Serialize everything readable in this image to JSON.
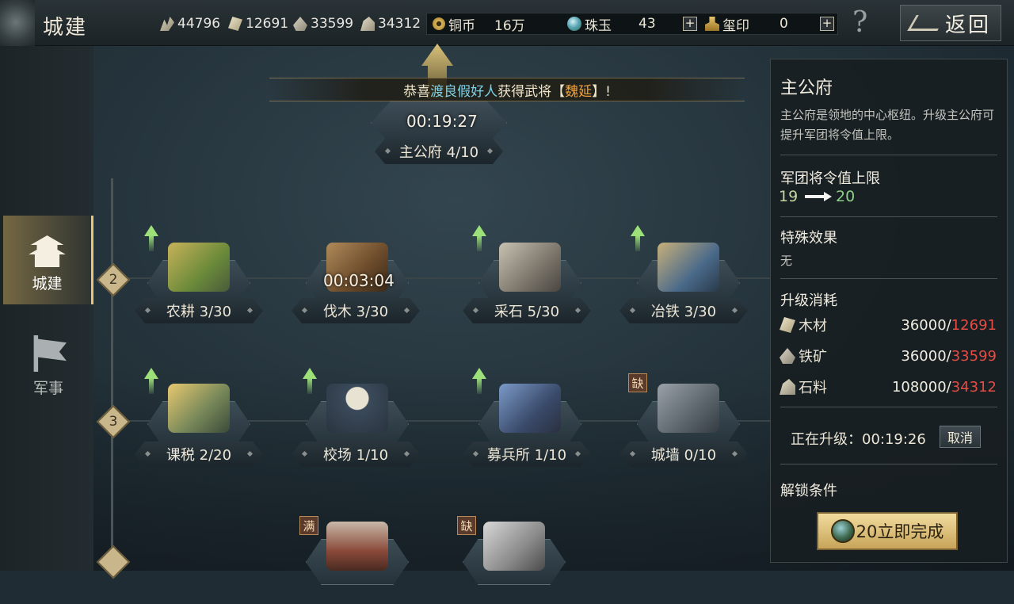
{
  "header": {
    "title": "城建",
    "resources": [
      {
        "icon": "grain-icon",
        "value": "44796"
      },
      {
        "icon": "wood-icon",
        "value": "12691"
      },
      {
        "icon": "iron-ore-icon",
        "value": "33599"
      },
      {
        "icon": "stone-icon",
        "value": "34312"
      }
    ],
    "copper": {
      "label": "铜币",
      "value": "16万"
    },
    "jade": {
      "label": "珠玉",
      "value": "43"
    },
    "seal": {
      "label": "玺印",
      "value": "0"
    },
    "plus_label": "+",
    "help_label": "?",
    "back_label": "返回"
  },
  "sidebar": {
    "tabs": [
      {
        "label": "城建",
        "active": true
      },
      {
        "label": "军事",
        "active": false
      }
    ]
  },
  "announcement": {
    "prefix": "恭喜",
    "player": "渡良假好人",
    "middle": "获得武将【",
    "hero": "魏延",
    "suffix": "】!"
  },
  "main_hall": {
    "timer": "00:19:27",
    "label": "主公府 4/10"
  },
  "levels": [
    "2",
    "3"
  ],
  "buildings_row2": [
    {
      "label": "农耕 3/30",
      "upgrade": true,
      "timer": ""
    },
    {
      "label": "伐木 3/30",
      "upgrade": false,
      "timer": "00:03:04"
    },
    {
      "label": "采石 5/30",
      "upgrade": true,
      "timer": ""
    },
    {
      "label": "冶铁 3/30",
      "upgrade": true,
      "timer": ""
    }
  ],
  "buildings_row3": [
    {
      "label": "课税 2/20",
      "upgrade": true
    },
    {
      "label": "校场 1/10",
      "upgrade": true
    },
    {
      "label": "募兵所 1/10",
      "upgrade": true
    },
    {
      "label": "城墙 0/10",
      "upgrade": false,
      "tag": "缺"
    }
  ],
  "row4_tags": [
    "满",
    "缺"
  ],
  "detail_panel": {
    "title": "主公府",
    "description": "主公府是领地的中心枢纽。升级主公府可提升军团将令值上限。",
    "stat_label": "军团将令值上限",
    "stat_from": "19",
    "stat_to": "20",
    "special_label": "特殊效果",
    "special_value": "无",
    "cost_label": "升级消耗",
    "costs": [
      {
        "icon": "wood-icon",
        "name": "木材",
        "need": "36000",
        "have": "12691"
      },
      {
        "icon": "iron-ore-icon",
        "name": "铁矿",
        "need": "36000",
        "have": "33599"
      },
      {
        "icon": "stone-icon",
        "name": "石料",
        "need": "108000",
        "have": "34312"
      }
    ],
    "upgrading_text": "正在升级：00:19:26",
    "cancel_label": "取消",
    "unlock_label": "解锁条件",
    "finish_label": "20立即完成"
  },
  "colors": {
    "accent_gold": "#e6c77a",
    "insufficient_red": "#e44c44",
    "stat_green": "#8fd08a",
    "upgrade_arrow": "#9de07a"
  }
}
